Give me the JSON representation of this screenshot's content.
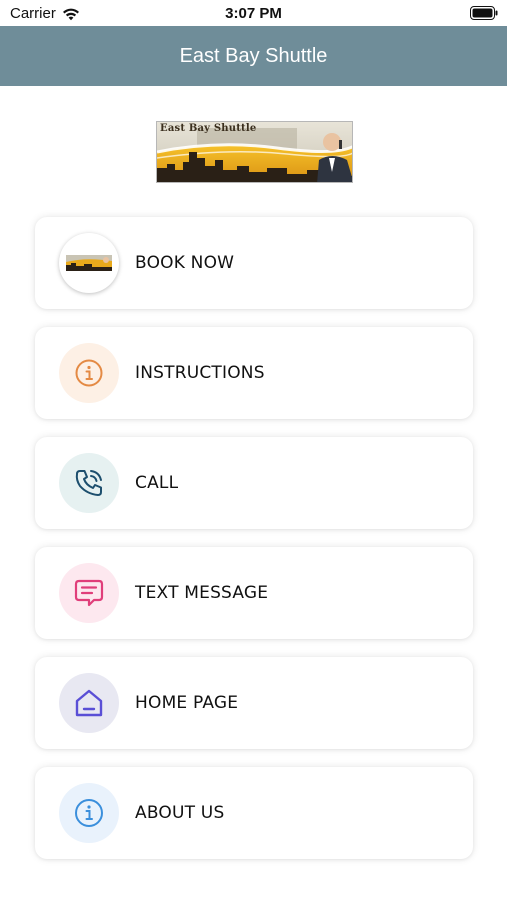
{
  "status_bar": {
    "carrier": "Carrier",
    "time": "3:07 PM"
  },
  "nav": {
    "title": "East Bay Shuttle",
    "color": "#6f8d99"
  },
  "logo": {
    "text": "East Bay Shuttle"
  },
  "menu": {
    "items": [
      {
        "label": "BOOK NOW",
        "icon": "shuttle-thumbnail-icon",
        "circle_color": "#ffffff"
      },
      {
        "label": "INSTRUCTIONS",
        "icon": "info-icon",
        "circle_color": "#fdf0e5",
        "icon_color": "#e48a44"
      },
      {
        "label": "CALL",
        "icon": "phone-call-icon",
        "circle_color": "#e6f1f1",
        "icon_color": "#1d4f6e"
      },
      {
        "label": "TEXT MESSAGE",
        "icon": "message-icon",
        "circle_color": "#fde8ef",
        "icon_color": "#e03e7a"
      },
      {
        "label": "HOME PAGE",
        "icon": "home-icon",
        "circle_color": "#e8e8f2",
        "icon_color": "#5a4fd6"
      },
      {
        "label": "ABOUT US",
        "icon": "info-icon",
        "circle_color": "#e9f2fc",
        "icon_color": "#3b8fdc"
      }
    ]
  }
}
